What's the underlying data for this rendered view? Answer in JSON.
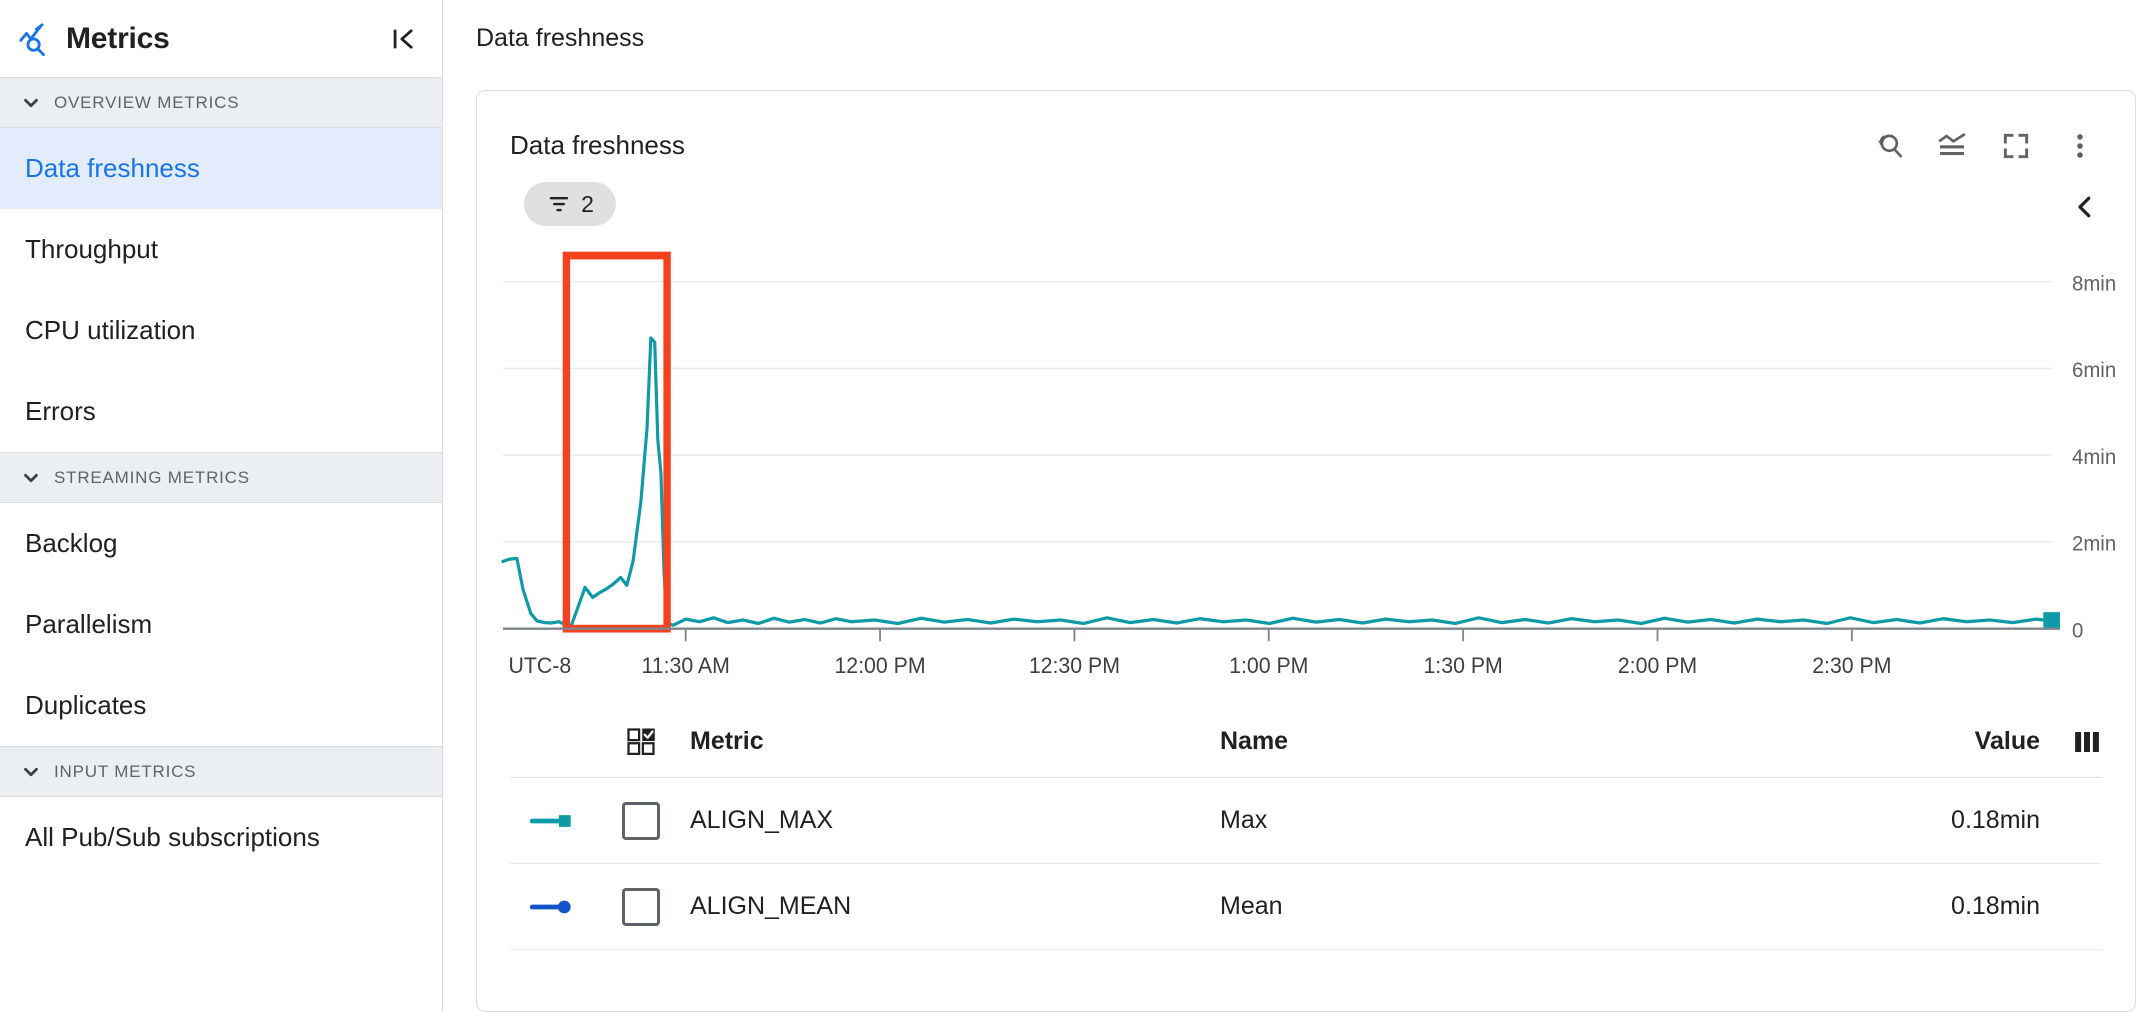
{
  "sidebar": {
    "title": "Metrics",
    "brand_icon": "metrics-explorer-icon",
    "collapse_icon": "collapse-panel-icon",
    "sections": [
      {
        "label": "OVERVIEW METRICS",
        "chevron_icon": "chevron-down-icon",
        "items": [
          {
            "label": "Data freshness",
            "selected": true
          },
          {
            "label": "Throughput",
            "selected": false
          },
          {
            "label": "CPU utilization",
            "selected": false
          },
          {
            "label": "Errors",
            "selected": false
          }
        ]
      },
      {
        "label": "STREAMING METRICS",
        "chevron_icon": "chevron-down-icon",
        "items": [
          {
            "label": "Backlog",
            "selected": false
          },
          {
            "label": "Parallelism",
            "selected": false
          },
          {
            "label": "Duplicates",
            "selected": false
          }
        ]
      },
      {
        "label": "INPUT METRICS",
        "chevron_icon": "chevron-down-icon",
        "items": [
          {
            "label": "All Pub/Sub subscriptions",
            "selected": false
          }
        ]
      }
    ]
  },
  "header": {
    "title": "Data freshness"
  },
  "card": {
    "title": "Data freshness",
    "tools": [
      {
        "name": "reset-zoom-icon",
        "label": "Reset zoom"
      },
      {
        "name": "chart-style-icon",
        "label": "Chart style"
      },
      {
        "name": "fullscreen-icon",
        "label": "Fullscreen"
      },
      {
        "name": "more-options-icon",
        "label": "More options"
      }
    ],
    "filter_chip": {
      "icon": "filter-icon",
      "count": "2"
    },
    "legend_toggle_icon": "chevron-left-icon"
  },
  "chart_data": {
    "type": "line",
    "title": "Data freshness",
    "xlabel": "",
    "ylabel": "",
    "timezone_label": "UTC-8",
    "x_ticks": [
      "11:30 AM",
      "12:00 PM",
      "12:30 PM",
      "1:00 PM",
      "1:30 PM",
      "2:00 PM",
      "2:30 PM"
    ],
    "y_ticks": [
      "0",
      "2min",
      "4min",
      "6min",
      "8min"
    ],
    "ylim": [
      0,
      8.6
    ],
    "y_unit": "min",
    "grid": true,
    "legend_position": "bottom-table",
    "annotation": {
      "type": "rectangle",
      "color": "#f4411e",
      "x_start_frac": 0.041,
      "x_end_frac": 0.106,
      "y_top": 8.6,
      "y_bottom": 0
    },
    "series": [
      {
        "name": "ALIGN_MAX",
        "display_name": "Max",
        "color": "#0e9aa7",
        "marker": "square",
        "end_marker": true,
        "current_value": "0.18min",
        "points": [
          [
            0.0,
            1.55
          ],
          [
            0.004,
            1.6
          ],
          [
            0.009,
            1.62
          ],
          [
            0.013,
            0.9
          ],
          [
            0.018,
            0.35
          ],
          [
            0.022,
            0.18
          ],
          [
            0.027,
            0.14
          ],
          [
            0.031,
            0.13
          ],
          [
            0.036,
            0.16
          ],
          [
            0.04,
            0.1
          ],
          [
            0.044,
            0.06
          ],
          [
            0.049,
            0.55
          ],
          [
            0.053,
            0.95
          ],
          [
            0.058,
            0.72
          ],
          [
            0.062,
            0.82
          ],
          [
            0.067,
            0.92
          ],
          [
            0.071,
            1.02
          ],
          [
            0.076,
            1.18
          ],
          [
            0.08,
            1.0
          ],
          [
            0.084,
            1.55
          ],
          [
            0.089,
            2.9
          ],
          [
            0.093,
            4.6
          ],
          [
            0.0955,
            6.7
          ],
          [
            0.098,
            6.6
          ],
          [
            0.1,
            4.35
          ],
          [
            0.102,
            3.6
          ],
          [
            0.104,
            1.3
          ],
          [
            0.106,
            0.12
          ],
          [
            0.11,
            0.08
          ],
          [
            0.118,
            0.22
          ],
          [
            0.127,
            0.16
          ],
          [
            0.136,
            0.25
          ],
          [
            0.145,
            0.14
          ],
          [
            0.155,
            0.2
          ],
          [
            0.165,
            0.12
          ],
          [
            0.175,
            0.24
          ],
          [
            0.185,
            0.15
          ],
          [
            0.195,
            0.21
          ],
          [
            0.205,
            0.13
          ],
          [
            0.215,
            0.23
          ],
          [
            0.225,
            0.16
          ],
          [
            0.24,
            0.2
          ],
          [
            0.255,
            0.12
          ],
          [
            0.27,
            0.24
          ],
          [
            0.285,
            0.15
          ],
          [
            0.3,
            0.21
          ],
          [
            0.315,
            0.13
          ],
          [
            0.33,
            0.22
          ],
          [
            0.345,
            0.16
          ],
          [
            0.36,
            0.2
          ],
          [
            0.375,
            0.12
          ],
          [
            0.39,
            0.25
          ],
          [
            0.405,
            0.14
          ],
          [
            0.42,
            0.21
          ],
          [
            0.435,
            0.13
          ],
          [
            0.45,
            0.23
          ],
          [
            0.465,
            0.16
          ],
          [
            0.48,
            0.2
          ],
          [
            0.495,
            0.12
          ],
          [
            0.51,
            0.24
          ],
          [
            0.525,
            0.15
          ],
          [
            0.54,
            0.21
          ],
          [
            0.555,
            0.13
          ],
          [
            0.57,
            0.22
          ],
          [
            0.585,
            0.16
          ],
          [
            0.6,
            0.2
          ],
          [
            0.615,
            0.12
          ],
          [
            0.63,
            0.25
          ],
          [
            0.645,
            0.14
          ],
          [
            0.66,
            0.21
          ],
          [
            0.675,
            0.13
          ],
          [
            0.69,
            0.23
          ],
          [
            0.705,
            0.16
          ],
          [
            0.72,
            0.2
          ],
          [
            0.735,
            0.12
          ],
          [
            0.75,
            0.24
          ],
          [
            0.765,
            0.15
          ],
          [
            0.78,
            0.21
          ],
          [
            0.795,
            0.13
          ],
          [
            0.81,
            0.22
          ],
          [
            0.825,
            0.16
          ],
          [
            0.84,
            0.2
          ],
          [
            0.855,
            0.12
          ],
          [
            0.87,
            0.25
          ],
          [
            0.885,
            0.14
          ],
          [
            0.9,
            0.21
          ],
          [
            0.915,
            0.13
          ],
          [
            0.93,
            0.23
          ],
          [
            0.945,
            0.16
          ],
          [
            0.96,
            0.2
          ],
          [
            0.975,
            0.14
          ],
          [
            0.99,
            0.22
          ],
          [
            1.0,
            0.18
          ]
        ]
      },
      {
        "name": "ALIGN_MEAN",
        "display_name": "Mean",
        "color": "#1454c8",
        "marker": "circle",
        "end_marker": false,
        "current_value": "0.18min",
        "points": []
      }
    ]
  },
  "table": {
    "columns": {
      "metric": "Metric",
      "name": "Name",
      "value": "Value"
    },
    "select_all_icon": "select-all-grid-icon",
    "column_settings_icon": "column-settings-icon",
    "rows": [
      {
        "metric": "ALIGN_MAX",
        "name": "Max",
        "value": "0.18min",
        "color": "#0e9aa7",
        "marker": "square",
        "checked": false
      },
      {
        "metric": "ALIGN_MEAN",
        "name": "Mean",
        "value": "0.18min",
        "color": "#1454c8",
        "marker": "circle",
        "checked": false
      }
    ]
  }
}
